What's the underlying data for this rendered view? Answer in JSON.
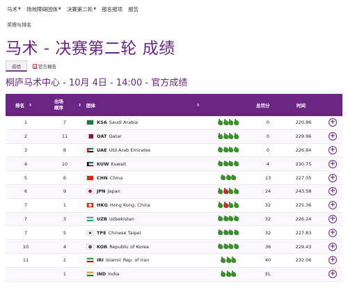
{
  "nav": {
    "items": [
      {
        "label": "马术",
        "caret": true
      },
      {
        "label": "场地障碍团体",
        "caret": true
      },
      {
        "label": "决赛第二轮",
        "caret": true
      },
      {
        "label": "报名报项",
        "caret": false
      },
      {
        "label": "报告",
        "caret": false
      }
    ],
    "sub_item": "奖牌与排名"
  },
  "page_title": "马术 - 决赛第二轮 成绩",
  "tabs": [
    {
      "label": "成绩",
      "active": true
    },
    {
      "label": "官方报告",
      "active": false
    }
  ],
  "session": "桐庐马术中心 - 10月 4日 - 14:00 - 官方成绩",
  "table": {
    "headers": {
      "rank": "排名",
      "order_line1": "出场",
      "order_line2": "顺序",
      "team": "团体",
      "points": "总罚分",
      "time": "时间"
    },
    "rows": [
      {
        "rank": "1",
        "order": "7",
        "noc": "KSA",
        "name": "Saudi Arabia",
        "flag": "ksa",
        "horses": [
          "green",
          "green",
          "green",
          "green"
        ],
        "points": "0",
        "time": "220.86"
      },
      {
        "rank": "2",
        "order": "11",
        "noc": "QAT",
        "name": "Qatar",
        "flag": "qat",
        "horses": [
          "green",
          "green",
          "green",
          "green"
        ],
        "points": "0",
        "time": "229.96"
      },
      {
        "rank": "3",
        "order": "8",
        "noc": "UAE",
        "name": "Utd Arab Emirates",
        "flag": "uae",
        "horses": [
          "green",
          "green",
          "green",
          "green"
        ],
        "points": "0",
        "time": "226.84"
      },
      {
        "rank": "4",
        "order": "10",
        "noc": "KUW",
        "name": "Kuwait",
        "flag": "kuw",
        "horses": [
          "green",
          "green",
          "green",
          "green"
        ],
        "points": "4",
        "time": "230.75"
      },
      {
        "rank": "5",
        "order": "6",
        "noc": "CHN",
        "name": "China",
        "flag": "chn",
        "horses": [
          "green",
          "green",
          "green"
        ],
        "points": "13",
        "time": "227.05"
      },
      {
        "rank": "6",
        "order": "9",
        "noc": "JPN",
        "name": "Japan",
        "flag": "jpn",
        "horses": [
          "green",
          "red",
          "green",
          "green"
        ],
        "points": "24",
        "time": "243.58"
      },
      {
        "rank": "7",
        "order": "1",
        "noc": "HKG",
        "name": "Hong Kong, China",
        "flag": "hkg",
        "horses": [
          "green",
          "red",
          "green",
          "green"
        ],
        "points": "32",
        "time": "225.36"
      },
      {
        "rank": "7",
        "order": "3",
        "noc": "UZB",
        "name": "Uzbekistan",
        "flag": "uzb",
        "horses": [
          "green",
          "green",
          "green",
          "green"
        ],
        "points": "32",
        "time": "226.24"
      },
      {
        "rank": "7",
        "order": "5",
        "noc": "TPE",
        "name": "Chinese Taipei",
        "flag": "tpe",
        "horses": [
          "green",
          "green",
          "green",
          "green"
        ],
        "points": "32",
        "time": "227.83"
      },
      {
        "rank": "10",
        "order": "4",
        "noc": "KOR",
        "name": "Republic of Korea",
        "flag": "kor",
        "horses": [
          "green",
          "green",
          "green",
          "green"
        ],
        "points": "36",
        "time": "229.43"
      },
      {
        "rank": "11",
        "order": "2",
        "noc": "IRI",
        "name": "Islamic Rep. of Iran",
        "flag": "iri",
        "horses": [
          "green",
          "green",
          "green"
        ],
        "points": "40",
        "time": "232.06"
      },
      {
        "rank": "",
        "order": "1",
        "noc": "IND",
        "name": "India",
        "flag": "ind",
        "horses": [
          "green",
          "green",
          "green"
        ],
        "points": "EL",
        "time": ""
      }
    ]
  },
  "colors": {
    "accent": "#6b2583",
    "horse_ok": "#3a8f2c",
    "horse_fault": "#cc2a2a"
  }
}
